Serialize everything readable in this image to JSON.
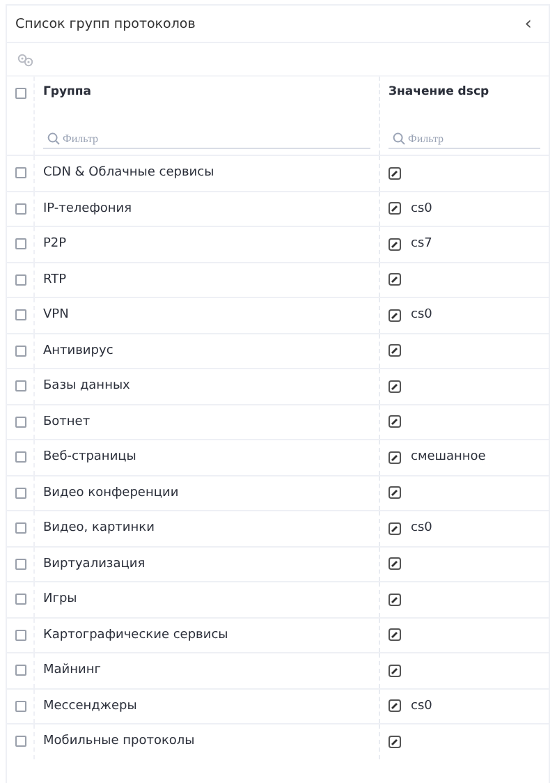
{
  "panel": {
    "title": "Список групп протоколов",
    "collapse_icon": "‹"
  },
  "table": {
    "select_all": {
      "checked": false
    },
    "columns": [
      {
        "label": "Группа",
        "filter_placeholder": "Фильтр"
      },
      {
        "label": "Значение dscp",
        "filter_placeholder": "Фильтр"
      }
    ],
    "rows": [
      {
        "checked": false,
        "group": "CDN & Облачные сервисы"
      },
      {
        "checked": false,
        "group": "IP-телефония",
        "dscp": "cs0"
      },
      {
        "checked": false,
        "group": "P2P",
        "dscp": "cs7"
      },
      {
        "checked": false,
        "group": "RTP"
      },
      {
        "checked": false,
        "group": "VPN",
        "dscp": "cs0"
      },
      {
        "checked": false,
        "group": "Антивирус"
      },
      {
        "checked": false,
        "group": "Базы данных"
      },
      {
        "checked": false,
        "group": "Ботнет"
      },
      {
        "checked": false,
        "group": "Веб-страницы",
        "dscp": "смешанное"
      },
      {
        "checked": false,
        "group": "Видео конференции"
      },
      {
        "checked": false,
        "group": "Видео, картинки",
        "dscp": "cs0"
      },
      {
        "checked": false,
        "group": "Виртуализация"
      },
      {
        "checked": false,
        "group": "Игры"
      },
      {
        "checked": false,
        "group": "Картографические сервисы"
      },
      {
        "checked": false,
        "group": "Майнинг"
      },
      {
        "checked": false,
        "group": "Мессенджеры",
        "dscp": "cs0"
      },
      {
        "checked": false,
        "group": "Мобильные протоколы"
      }
    ]
  }
}
